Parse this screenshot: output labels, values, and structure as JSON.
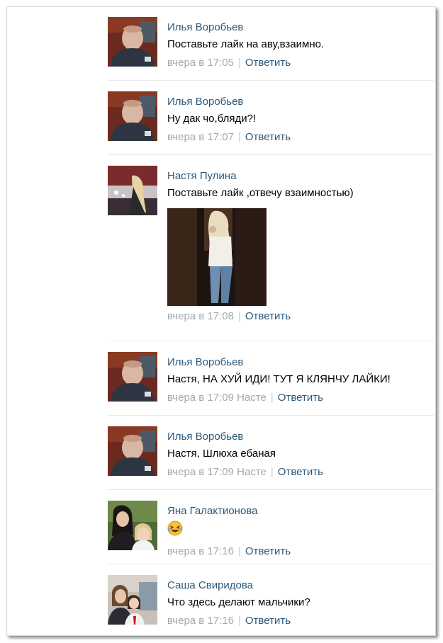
{
  "comments": [
    {
      "author": "Илья Воробьев",
      "text": "Поставьте лайк на аву,взаимно.",
      "time": "вчера в 17:05",
      "reply_label": "Ответить",
      "avatar_icon": "avatar-man-icon"
    },
    {
      "author": "Илья Воробьев",
      "text": "Ну дак чо,бляди?!",
      "time": "вчера в 17:07",
      "reply_label": "Ответить",
      "avatar_icon": "avatar-man-icon"
    },
    {
      "author": "Настя Пулина",
      "text": "Поставьте лайк ,отвечу взаимностью)",
      "time": "вчера в 17:08",
      "reply_label": "Ответить",
      "avatar_icon": "avatar-girl-icon",
      "attachment_icon": "photo-attachment-icon"
    },
    {
      "author": "Илья Воробьев",
      "text": "Настя, НА ХУЙ ИДИ! ТУТ Я КЛЯНЧУ ЛАЙКИ!",
      "time": "вчера в 17:09 Насте",
      "reply_label": "Ответить",
      "avatar_icon": "avatar-man-icon"
    },
    {
      "author": "Илья Воробьев",
      "text": "Настя, Шлюха ебаная",
      "time": "вчера в 17:09 Насте",
      "reply_label": "Ответить",
      "avatar_icon": "avatar-man-icon"
    },
    {
      "author": "Яна Галактионова",
      "emoji_icon": "laughing-tears-emoji-icon",
      "time": "вчера в 17:16",
      "reply_label": "Ответить",
      "avatar_icon": "avatar-two-girls-icon"
    },
    {
      "author": "Саша Свиридова",
      "text": "Что здесь делают мальчики?",
      "time": "вчера в 17:16",
      "reply_label": "Ответить",
      "avatar_icon": "avatar-girls-school-icon"
    }
  ],
  "colors": {
    "author_link": "#2b587a",
    "meta_gray": "#a4a8ac",
    "separator": "#e7eaed"
  }
}
